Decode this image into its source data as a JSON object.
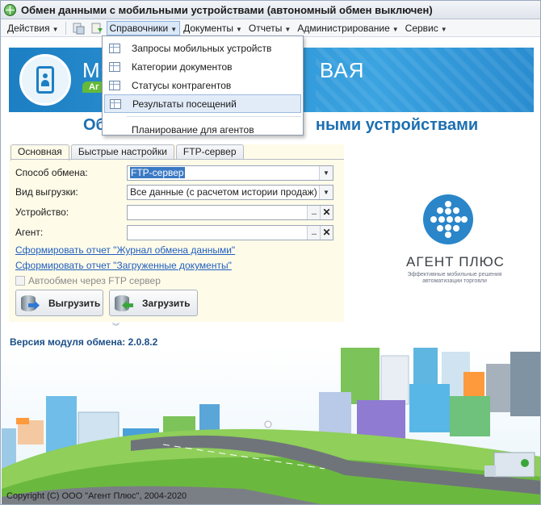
{
  "window": {
    "title": "Обмен данными с мобильными устройствами (автономный обмен выключен)"
  },
  "menubar": {
    "items": [
      {
        "label": "Действия"
      },
      {
        "label": "Справочники"
      },
      {
        "label": "Документы"
      },
      {
        "label": "Отчеты"
      },
      {
        "label": "Администрирование"
      },
      {
        "label": "Сервис"
      }
    ],
    "active_item": "Справочники"
  },
  "dropdown": {
    "items": [
      {
        "label": "Запросы мобильных устройств"
      },
      {
        "label": "Категории документов"
      },
      {
        "label": "Статусы контрагентов"
      },
      {
        "label": "Результаты посещений"
      },
      {
        "label": "Планирование для агентов"
      }
    ],
    "highlighted": "Результаты посещений"
  },
  "banner": {
    "title_start": "МО",
    "title_end": "ВАЯ",
    "badge": "Аг"
  },
  "heading": {
    "left": "Об",
    "right": "ными устройствами"
  },
  "tabs": [
    {
      "label": "Основная"
    },
    {
      "label": "Быстрые настройки"
    },
    {
      "label": "FTP-сервер"
    }
  ],
  "form": {
    "exchange_method": {
      "label": "Способ обмена:",
      "value": "FTP-сервер"
    },
    "export_type": {
      "label": "Вид выгрузки:",
      "value": "Все данные (с расчетом истории продаж)"
    },
    "device": {
      "label": "Устройство:",
      "value": ""
    },
    "agent": {
      "label": "Агент:",
      "value": ""
    },
    "link_journal": "Сформировать отчет \"Журнал обмена данными\"",
    "link_loaded": "Сформировать отчет \"Загруженные документы\"",
    "auto_exchange": {
      "label": "Автообмен через FTP сервер",
      "checked": false,
      "enabled": false
    },
    "upload_button": "Выгрузить",
    "download_button": "Загрузить"
  },
  "version": "Версия модуля обмена: 2.0.8.2",
  "brand": {
    "name": "АГЕНТ ПЛЮС",
    "tagline": "Эффективные мобильные решения автоматизации торговли"
  },
  "footer": {
    "copyright": "Copyright (C) ООО \"Агент Плюс\", 2004-2020"
  },
  "colors": {
    "accent": "#1c6fb1",
    "banner": "#2a8cd0",
    "link": "#1f5fbf",
    "form_bg": "#fffbe9"
  }
}
